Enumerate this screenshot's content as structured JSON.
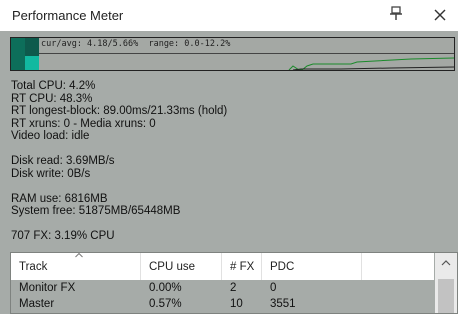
{
  "window": {
    "title": "Performance Meter",
    "pin_icon": "pin-icon",
    "close_icon": "close-icon"
  },
  "meter": {
    "label": "cur/avg: 4.18/5.66%  range: 0.0-12.2%",
    "cpu_cur_percent": 4.18,
    "cpu_avg_percent": 5.66,
    "range_min_percent": 0.0,
    "range_max_percent": 12.2,
    "colors": {
      "bar_dark": "#0d6e5a",
      "bar_light": "#12b9a0",
      "graph_line": "#1a8a2a"
    }
  },
  "stats": {
    "total_cpu": "Total CPU: 4.2%",
    "rt_cpu": "RT CPU: 48.3%",
    "rt_longest_block": "RT longest-block: 89.00ms/21.33ms (hold)",
    "rt_xruns": "RT xruns: 0 - Media xruns: 0",
    "video_load": "Video load: idle",
    "disk_read": "Disk read: 3.69MB/s",
    "disk_write": "Disk write: 0B/s",
    "ram_use": "RAM use: 6816MB",
    "system_free": "System free: 51875MB/65448MB",
    "fx_summary": "707 FX: 3.19% CPU"
  },
  "table": {
    "columns": [
      "Track",
      "CPU use",
      "# FX",
      "PDC"
    ],
    "sort_icon": "chevron-up-icon",
    "rows": [
      [
        "Monitor FX",
        "0.00%",
        "2",
        "0"
      ],
      [
        "Master",
        "0.57%",
        "10",
        "3551"
      ]
    ]
  }
}
